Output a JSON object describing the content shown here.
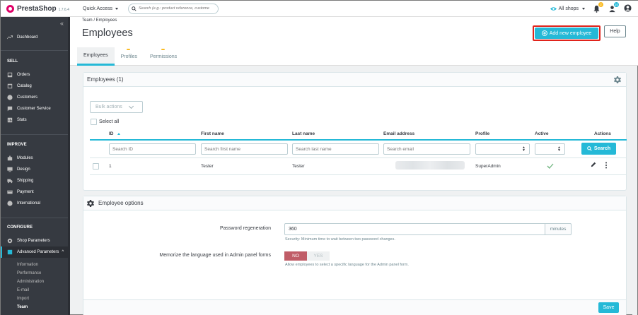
{
  "topbar": {
    "logo_text": "PrestaShop",
    "version": "1.7.6.4",
    "quick_access": "Quick Access",
    "search_placeholder": "Search (e.g.: product reference, custome",
    "shops_label": "All shops",
    "orders_badge": "2",
    "customers_badge": "10"
  },
  "sidebar": {
    "dashboard": "Dashboard",
    "sell_title": "SELL",
    "orders": "Orders",
    "catalog": "Catalog",
    "customers": "Customers",
    "customer_service": "Customer Service",
    "stats": "Stats",
    "improve_title": "IMPROVE",
    "modules": "Modules",
    "design": "Design",
    "shipping": "Shipping",
    "payment": "Payment",
    "international": "International",
    "configure_title": "CONFIGURE",
    "shop_parameters": "Shop Parameters",
    "advanced_parameters": "Advanced Parameters",
    "sub": {
      "information": "Information",
      "performance": "Performance",
      "administration": "Administration",
      "email": "E-mail",
      "import": "Import",
      "team": "Team"
    }
  },
  "header": {
    "breadcrumb": "Team /  Employees",
    "title": "Employees",
    "add_button": "Add new employee",
    "help_button": "Help",
    "tabs": [
      "Employees",
      "Profiles",
      "Permissions"
    ]
  },
  "employees_panel": {
    "title": "Employees (1)",
    "bulk_actions": "Bulk actions",
    "select_all": "Select all",
    "columns": {
      "id": "ID",
      "first_name": "First name",
      "last_name": "Last name",
      "email": "Email address",
      "profile": "Profile",
      "active": "Active",
      "actions": "Actions"
    },
    "filters": {
      "id": "Search ID",
      "first_name": "Search first name",
      "last_name": "Search last name",
      "email": "Search email"
    },
    "search_button": "Search",
    "rows": [
      {
        "id": "1",
        "first_name": "Tester",
        "last_name": "Tester",
        "profile": "SuperAdmin",
        "active": true
      }
    ]
  },
  "options_panel": {
    "title": "Employee options",
    "password_label": "Password regeneration",
    "password_value": "360",
    "password_unit": "minutes",
    "password_help": "Security: Minimum time to wait between two password changes.",
    "language_label": "Memorize the language used in Admin panel forms",
    "toggle_no": "NO",
    "toggle_yes": "YES",
    "language_help": "Allow employees to select a specific language for the Admin panel form.",
    "save_button": "Save"
  },
  "colors": {
    "accent": "#25b9d7",
    "sidebar_bg": "#363a41",
    "highlight_border": "#e0231b",
    "toggle_no": "#c05c67"
  }
}
